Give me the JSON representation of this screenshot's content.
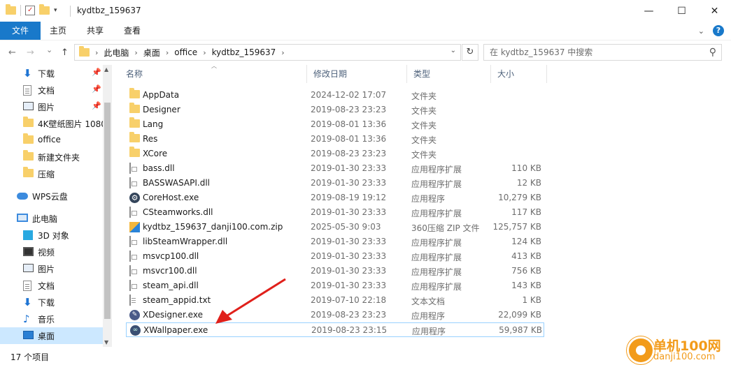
{
  "window": {
    "title": "kydtbz_159637",
    "controls": {
      "minimize": "—",
      "maximize": "☐",
      "close": "✕"
    }
  },
  "ribbon": {
    "tabs": [
      "文件",
      "主页",
      "共享",
      "查看"
    ],
    "help": "?"
  },
  "nav": {
    "back": "←",
    "forward": "→",
    "recent": "⌄",
    "up": "↑"
  },
  "breadcrumb": [
    "此电脑",
    "桌面",
    "office",
    "kydtbz_159637"
  ],
  "search": {
    "placeholder": "在 kydtbz_159637 中搜索"
  },
  "sidebar": {
    "items": [
      {
        "label": "下载",
        "icon": "download-icon",
        "pinned": true
      },
      {
        "label": "文档",
        "icon": "document-icon",
        "pinned": true
      },
      {
        "label": "图片",
        "icon": "picture-icon",
        "pinned": true
      },
      {
        "label": "4K壁纸图片 1080",
        "icon": "folder-icon"
      },
      {
        "label": "office",
        "icon": "folder-icon"
      },
      {
        "label": "新建文件夹",
        "icon": "folder-icon"
      },
      {
        "label": "压缩",
        "icon": "folder-icon"
      },
      {
        "label": "WPS云盘",
        "icon": "cloud-icon"
      },
      {
        "label": "此电脑",
        "icon": "computer-icon"
      },
      {
        "label": "3D 对象",
        "icon": "cube-icon"
      },
      {
        "label": "视频",
        "icon": "video-icon"
      },
      {
        "label": "图片",
        "icon": "picture-icon"
      },
      {
        "label": "文档",
        "icon": "document-icon"
      },
      {
        "label": "下载",
        "icon": "download-icon"
      },
      {
        "label": "音乐",
        "icon": "music-icon"
      },
      {
        "label": "桌面",
        "icon": "desktop-icon",
        "selected": true
      }
    ]
  },
  "columns": {
    "name": "名称",
    "date": "修改日期",
    "type": "类型",
    "size": "大小"
  },
  "files": [
    {
      "name": "AppData",
      "date": "2024-12-02 17:07",
      "type": "文件夹",
      "size": "",
      "icon": "folder-icon"
    },
    {
      "name": "Designer",
      "date": "2019-08-23 23:23",
      "type": "文件夹",
      "size": "",
      "icon": "folder-icon"
    },
    {
      "name": "Lang",
      "date": "2019-08-01 13:36",
      "type": "文件夹",
      "size": "",
      "icon": "folder-icon"
    },
    {
      "name": "Res",
      "date": "2019-08-01 13:36",
      "type": "文件夹",
      "size": "",
      "icon": "folder-icon"
    },
    {
      "name": "XCore",
      "date": "2019-08-23 23:23",
      "type": "文件夹",
      "size": "",
      "icon": "folder-icon"
    },
    {
      "name": "bass.dll",
      "date": "2019-01-30 23:33",
      "type": "应用程序扩展",
      "size": "110 KB",
      "icon": "dll-icon"
    },
    {
      "name": "BASSWASAPI.dll",
      "date": "2019-01-30 23:33",
      "type": "应用程序扩展",
      "size": "12 KB",
      "icon": "dll-icon"
    },
    {
      "name": "CoreHost.exe",
      "date": "2019-08-19 19:12",
      "type": "应用程序",
      "size": "10,279 KB",
      "icon": "gear-icon"
    },
    {
      "name": "CSteamworks.dll",
      "date": "2019-01-30 23:33",
      "type": "应用程序扩展",
      "size": "117 KB",
      "icon": "dll-icon"
    },
    {
      "name": "kydtbz_159637_danji100.com.zip",
      "date": "2025-05-30 9:03",
      "type": "360压缩 ZIP 文件",
      "size": "125,757 KB",
      "icon": "zip-icon"
    },
    {
      "name": "libSteamWrapper.dll",
      "date": "2019-01-30 23:33",
      "type": "应用程序扩展",
      "size": "124 KB",
      "icon": "dll-icon"
    },
    {
      "name": "msvcp100.dll",
      "date": "2019-01-30 23:33",
      "type": "应用程序扩展",
      "size": "413 KB",
      "icon": "dll-icon"
    },
    {
      "name": "msvcr100.dll",
      "date": "2019-01-30 23:33",
      "type": "应用程序扩展",
      "size": "756 KB",
      "icon": "dll-icon"
    },
    {
      "name": "steam_api.dll",
      "date": "2019-01-30 23:33",
      "type": "应用程序扩展",
      "size": "143 KB",
      "icon": "dll-icon"
    },
    {
      "name": "steam_appid.txt",
      "date": "2019-07-10 22:18",
      "type": "文本文档",
      "size": "1 KB",
      "icon": "text-file-icon"
    },
    {
      "name": "XDesigner.exe",
      "date": "2019-08-23 23:23",
      "type": "应用程序",
      "size": "22,099 KB",
      "icon": "xdesigner-icon"
    },
    {
      "name": "XWallpaper.exe",
      "date": "2019-08-23 23:15",
      "type": "应用程序",
      "size": "59,987 KB",
      "icon": "xwallpaper-icon",
      "selected": true
    }
  ],
  "status": {
    "item_count": "17 个项目"
  },
  "watermark": {
    "cn": "单机100网",
    "url": "danji100.com"
  },
  "colors": {
    "accent": "#1979ca",
    "selection": "#cce8ff",
    "arrow": "#e0201b",
    "watermark": "#f29b1a"
  }
}
